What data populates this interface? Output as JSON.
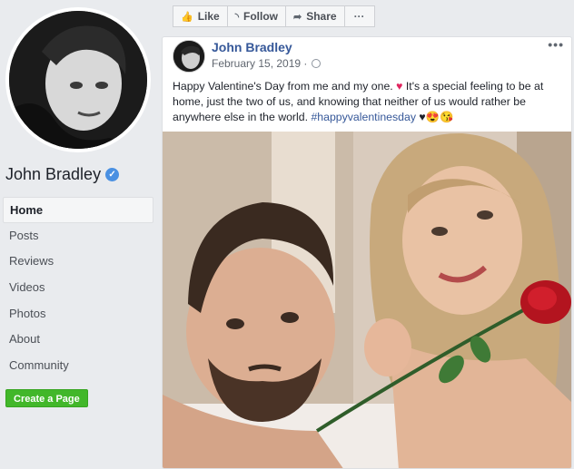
{
  "page": {
    "name": "John Bradley",
    "verified_icon": "check-badge-icon"
  },
  "nav": {
    "items": [
      {
        "label": "Home",
        "active": true
      },
      {
        "label": "Posts"
      },
      {
        "label": "Reviews"
      },
      {
        "label": "Videos"
      },
      {
        "label": "Photos"
      },
      {
        "label": "About"
      },
      {
        "label": "Community"
      }
    ],
    "create_page": "Create a Page"
  },
  "actions": {
    "like": "Like",
    "follow": "Follow",
    "share": "Share",
    "more": "···"
  },
  "post": {
    "author": "John Bradley",
    "date": "February 15, 2019 ·",
    "text_1": "Happy Valentine's Day from me and my one.",
    "heart_1": "♥",
    "text_2": " It's a special feeling to be at home, just the two of us, and knowing that neither of us would rather be anywhere else in the world. ",
    "hashtag": "#happyvalentinesday",
    "emoji_tail": "♥😍😘",
    "more": "•••"
  },
  "colors": {
    "link": "#365899",
    "create_button": "#42b72a"
  }
}
